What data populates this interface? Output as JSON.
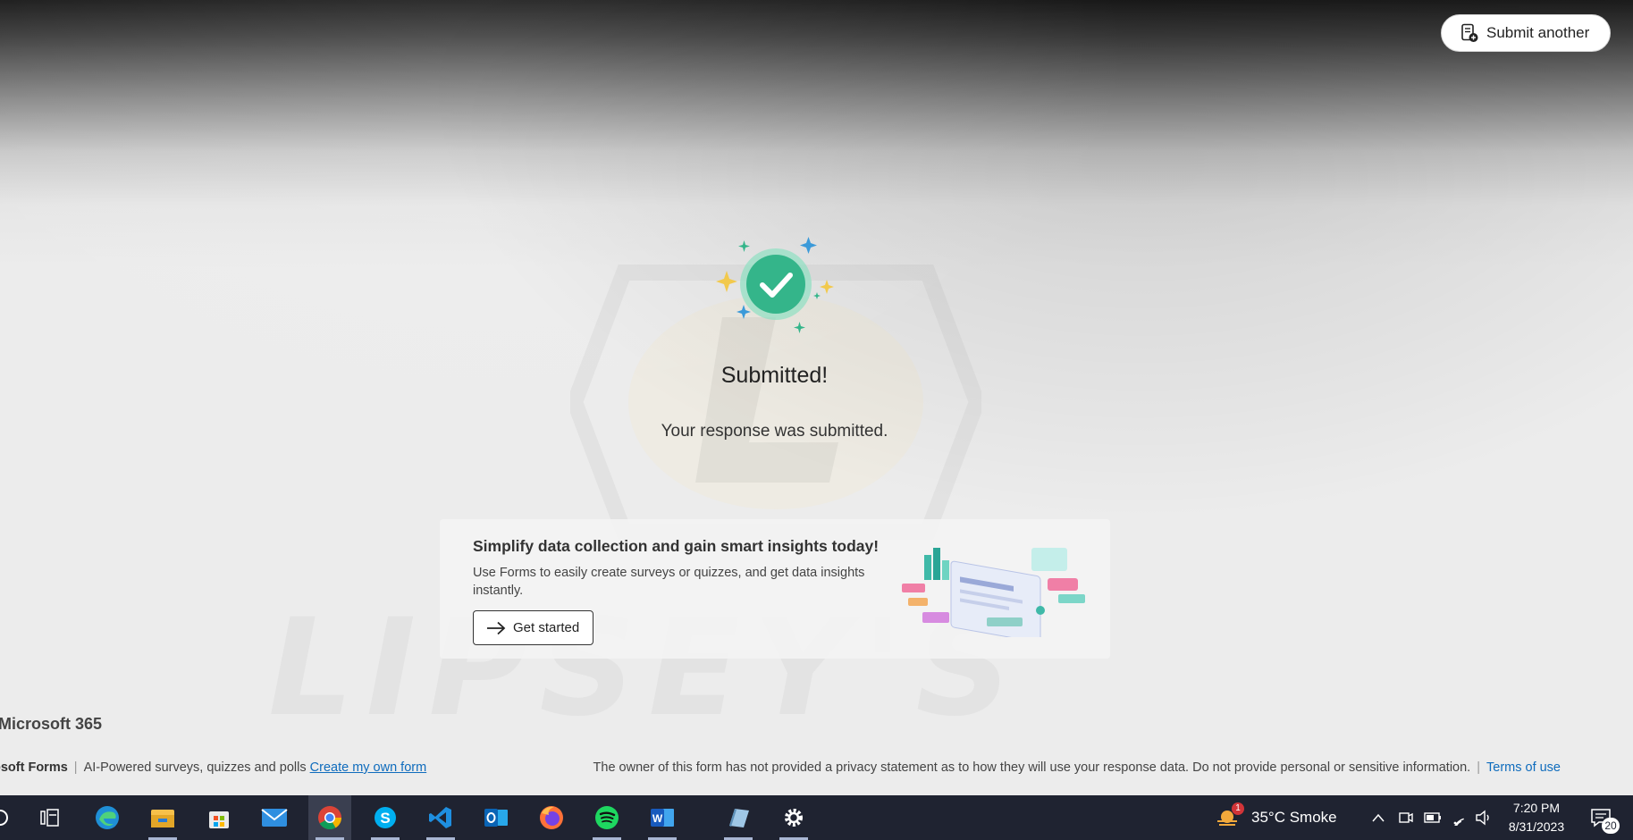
{
  "header": {
    "submit_another_label": "Submit another"
  },
  "confirmation": {
    "title": "Submitted!",
    "message": "Your response was submitted."
  },
  "promo": {
    "heading": "Simplify data collection and gain smart insights today!",
    "text": "Use Forms to easily create surveys or quizzes, and get data insights instantly.",
    "button_label": "Get started"
  },
  "watermark": {
    "word": "LIPSEY'S"
  },
  "footer": {
    "ms365": "Microsoft 365",
    "brand": "osoft Forms",
    "tagline": "AI-Powered surveys, quizzes and polls",
    "create_link": "Create my own form",
    "privacy_text": "The owner of this form has not provided a privacy statement as to how they will use your response data. Do not provide personal or sensitive information.",
    "terms_link": "Terms of use"
  },
  "taskbar": {
    "apps": [
      "search-icon",
      "task-view-icon",
      "edge-icon",
      "file-explorer-icon",
      "store-icon",
      "mail-icon",
      "chrome-icon",
      "skype-icon",
      "vscode-icon",
      "outlook-icon",
      "firefox-icon",
      "spotify-icon",
      "word-icon",
      "notes-icon",
      "settings-icon"
    ],
    "weather_badge": "1",
    "weather": "35°C  Smoke",
    "time": "7:20 PM",
    "date": "8/31/2023",
    "notification_count": "20"
  },
  "colors": {
    "accent_green": "#34b58a",
    "link_blue": "#0f6cbd",
    "taskbar_bg": "#1f2331"
  }
}
